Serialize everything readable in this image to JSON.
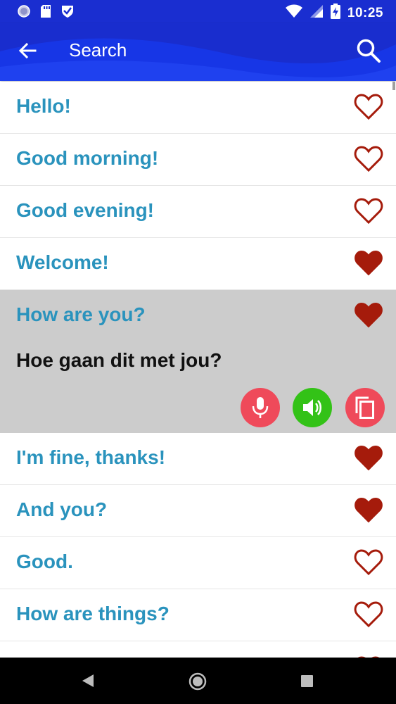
{
  "status_bar": {
    "time": "10:25",
    "icons": [
      "circle-app-icon",
      "sd-card-icon",
      "shield-check-icon",
      "wifi-icon",
      "signal-icon",
      "battery-charging-icon"
    ]
  },
  "app_bar": {
    "title": "Search",
    "back_icon": "arrow-left-icon",
    "search_icon": "search-icon"
  },
  "colors": {
    "app_bar": "#1736e6",
    "phrase_text": "#2a93bd",
    "heart": "#a51b0b",
    "expanded_bg": "#cccccc",
    "mic_button": "#ef4a5a",
    "speaker_button": "#33c217",
    "copy_button": "#ef4a5a"
  },
  "phrases": [
    {
      "text": "Hello!",
      "favorite": false
    },
    {
      "text": "Good morning!",
      "favorite": false
    },
    {
      "text": "Good evening!",
      "favorite": false
    },
    {
      "text": "Welcome!",
      "favorite": true
    },
    {
      "text": "How are you?",
      "favorite": true,
      "translation": "Hoe gaan dit met jou?",
      "expanded": true
    },
    {
      "text": "I'm fine, thanks!",
      "favorite": true
    },
    {
      "text": "And you?",
      "favorite": true
    },
    {
      "text": "Good.",
      "favorite": false
    },
    {
      "text": "How are things?",
      "favorite": false
    }
  ],
  "expanded_actions": [
    "microphone-icon",
    "speaker-icon",
    "copy-icon"
  ],
  "nav_bar": {
    "icons": [
      "nav-back-icon",
      "nav-home-icon",
      "nav-recents-icon"
    ]
  }
}
